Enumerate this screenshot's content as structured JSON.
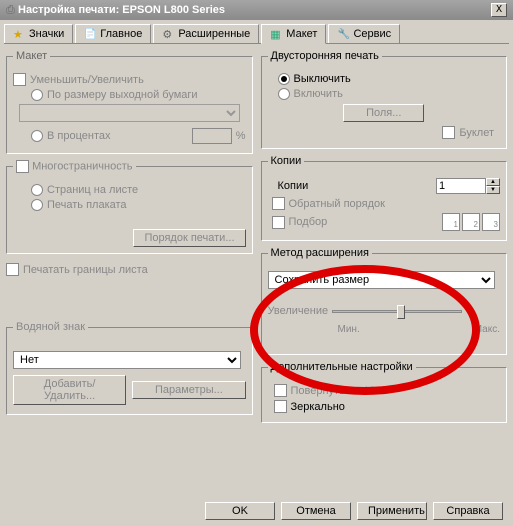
{
  "window": {
    "title": "Настройка печати: EPSON L800 Series",
    "close": "X"
  },
  "tabs": {
    "icons": "Значки",
    "main": "Главное",
    "advanced": "Расширенные",
    "layout": "Макет",
    "service": "Сервис"
  },
  "layout_group": {
    "title": "Макет",
    "reduce_enlarge": "Уменьшить/Увеличить",
    "fit_to_output": "По размеру выходной бумаги",
    "in_percent": "В процентах",
    "percent_unit": "%"
  },
  "multipage": {
    "title": "Многостраничность",
    "pages_per_sheet": "Страниц на листе",
    "poster": "Печать плаката",
    "print_order_btn": "Порядок печати..."
  },
  "print_borders": "Печатать границы листа",
  "watermark": {
    "title": "Водяной знак",
    "value": "Нет",
    "add_remove_btn": "Добавить/Удалить...",
    "params_btn": "Параметры..."
  },
  "duplex": {
    "title": "Двусторонняя печать",
    "off": "Выключить",
    "on": "Включить",
    "margins_btn": "Поля...",
    "booklet": "Буклет"
  },
  "copies": {
    "title": "Копии",
    "label": "Копии",
    "value": "1",
    "reverse": "Обратный порядок",
    "collate": "Подбор"
  },
  "expand": {
    "title": "Метод расширения",
    "value": "Сохранить размер",
    "zoom_label": "Увеличение",
    "min": "Мин.",
    "max": "Макс."
  },
  "additional": {
    "title": "Дополнительные настройки",
    "rotate180": "Повернуть на 180°",
    "mirror": "Зеркально"
  },
  "buttons": {
    "ok": "OK",
    "cancel": "Отмена",
    "apply": "Применить",
    "help": "Справка"
  }
}
